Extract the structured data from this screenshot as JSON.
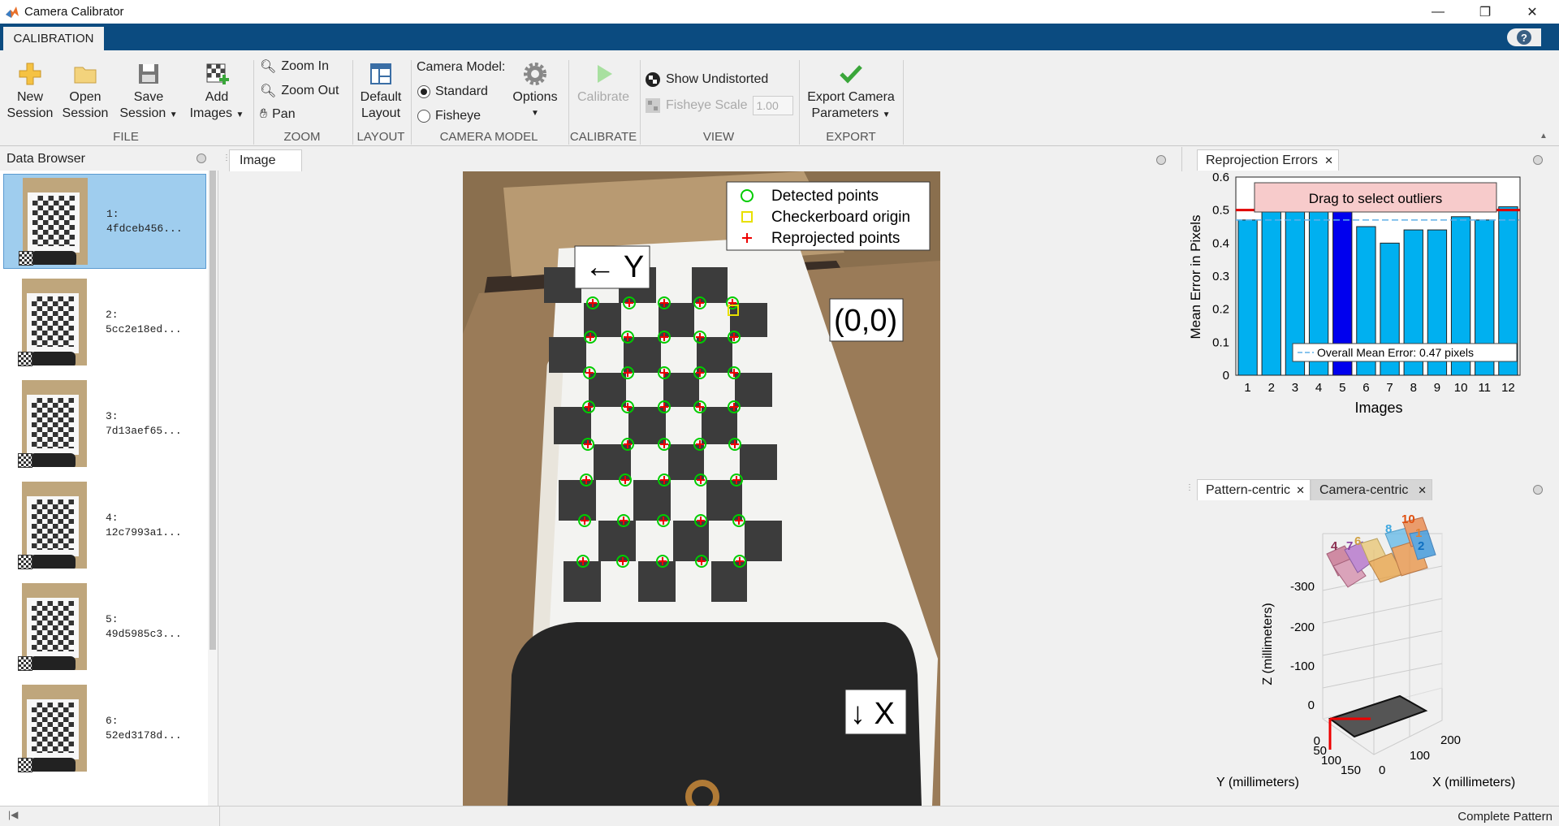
{
  "window": {
    "title": "Camera Calibrator",
    "min": "—",
    "max": "❐",
    "close": "✕"
  },
  "tabs": {
    "calibration": "CALIBRATION",
    "help": "?"
  },
  "ribbon": {
    "file": {
      "new_l1": "New",
      "new_l2": "Session",
      "open_l1": "Open",
      "open_l2": "Session",
      "save_l1": "Save",
      "save_l2": "Session",
      "add_l1": "Add",
      "add_l2": "Images",
      "section": "FILE"
    },
    "zoom": {
      "zoom_in": "Zoom In",
      "zoom_out": "Zoom Out",
      "pan": "Pan",
      "section": "ZOOM"
    },
    "layout": {
      "default_l1": "Default",
      "default_l2": "Layout",
      "section": "LAYOUT"
    },
    "camera_model": {
      "label": "Camera Model:",
      "standard": "Standard",
      "fisheye": "Fisheye",
      "options": "Options",
      "section": "CAMERA MODEL",
      "selected": "Standard"
    },
    "calibrate": {
      "label": "Calibrate",
      "section": "CALIBRATE"
    },
    "view": {
      "show_undistorted": "Show Undistorted",
      "fisheye_scale": "Fisheye Scale",
      "fisheye_value": "1.00",
      "section": "VIEW"
    },
    "export": {
      "l1": "Export Camera",
      "l2": "Parameters",
      "section": "EXPORT"
    }
  },
  "data_browser": {
    "title": "Data Browser",
    "items": [
      {
        "num": "1:",
        "hash": "4fdceb456..."
      },
      {
        "num": "2:",
        "hash": "5cc2e18ed..."
      },
      {
        "num": "3:",
        "hash": "7d13aef65..."
      },
      {
        "num": "4:",
        "hash": "12c7993a1..."
      },
      {
        "num": "5:",
        "hash": "49d5985c3..."
      },
      {
        "num": "6:",
        "hash": "52ed3178d..."
      }
    ],
    "selected_index": 0
  },
  "image_pane": {
    "tab": "Image",
    "legend": {
      "detected": "Detected points",
      "origin": "Checkerboard origin",
      "reprojected": "Reprojected points"
    },
    "label_y": "← Y",
    "label_origin": "(0,0)",
    "label_x": "↓ X"
  },
  "reprojection": {
    "tab": "Reprojection Errors",
    "drag_label": "Drag to select outliers",
    "mean_label": "Overall Mean Error: 0.47 pixels",
    "overall_mean": 0.47,
    "threshold": 0.5,
    "highlight_index": 4,
    "colors": {
      "bar": "#00b0f0",
      "highlight": "#0000ee",
      "threshold": "#e00000",
      "mean": "#60b0e8"
    }
  },
  "chart_data": {
    "type": "bar",
    "categories": [
      "1",
      "2",
      "3",
      "4",
      "5",
      "6",
      "7",
      "8",
      "9",
      "10",
      "11",
      "12"
    ],
    "values": [
      0.47,
      0.51,
      0.51,
      0.5,
      0.5,
      0.45,
      0.4,
      0.44,
      0.44,
      0.48,
      0.47,
      0.51
    ],
    "xlabel": "Images",
    "ylabel": "Mean Error in Pixels",
    "ylim": [
      0,
      0.6
    ],
    "yticks": [
      "0",
      "0.1",
      "0.2",
      "0.3",
      "0.4",
      "0.5",
      "0.6"
    ]
  },
  "extrinsics": {
    "tab_pattern": "Pattern-centric",
    "tab_camera": "Camera-centric",
    "zlabel": "Z (millimeters)",
    "ylabel": "Y (millimeters)",
    "xlabel": "X (millimeters)",
    "zticks": [
      "-300",
      "-200",
      "-100",
      "0"
    ],
    "yticks": [
      "0",
      "50",
      "100",
      "150"
    ],
    "xticks": [
      "0",
      "100",
      "200"
    ],
    "camera_labels": [
      "4",
      "7",
      "6",
      "8",
      "10",
      "1",
      "2"
    ]
  },
  "status": {
    "text": "Complete Pattern"
  }
}
